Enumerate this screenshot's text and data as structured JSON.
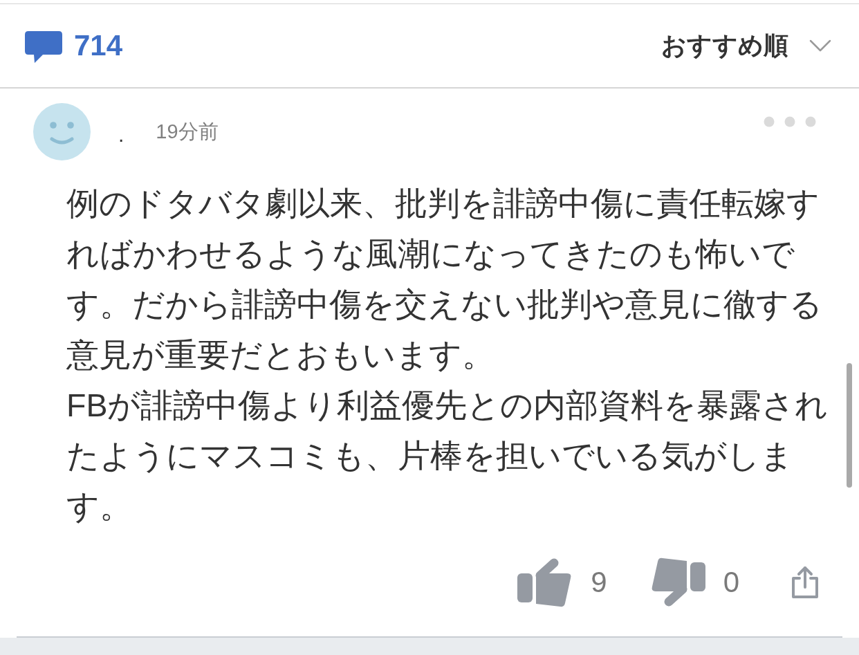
{
  "header": {
    "comment_count": "714",
    "sort_label": "おすすめ順"
  },
  "comment": {
    "author": ".",
    "time": "19分前",
    "body": [
      "例のドタバタ劇以来、批判を誹謗中傷に責任転嫁すればかわせるような風潮になってきたのも怖いです。だから誹謗中傷を交えない批判や意見に徹する意見が重要だとおもいます。",
      "FBが誹謗中傷より利益優先との内部資料を暴露されたようにマスコミも、片棒を担いでいる気がします。"
    ],
    "likes": "9",
    "dislikes": "0"
  }
}
